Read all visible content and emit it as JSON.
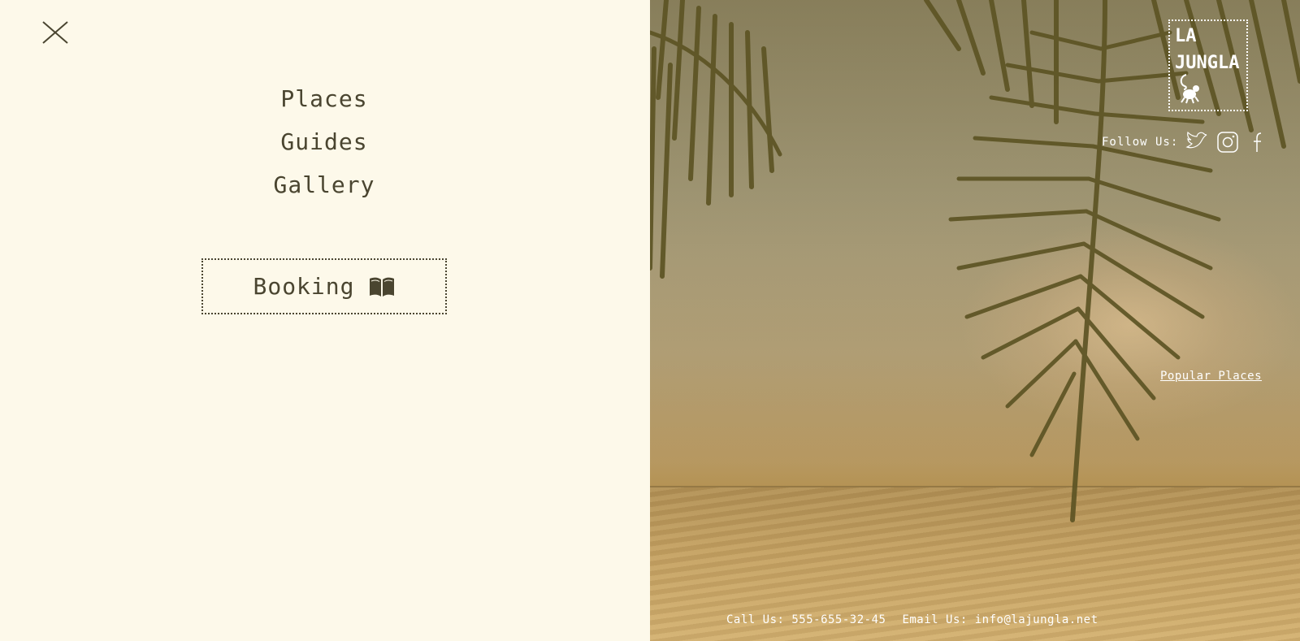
{
  "menu": {
    "close_icon": "close-icon",
    "items": [
      {
        "label": "Places"
      },
      {
        "label": "Guides"
      },
      {
        "label": "Gallery"
      }
    ],
    "booking": {
      "label": "Booking",
      "icon": "open-book-icon"
    }
  },
  "brand": {
    "line1": "LA",
    "line2": "JUNGLA",
    "icon": "monkey-icon"
  },
  "social": {
    "label": "Follow Us:",
    "icons": [
      "twitter-icon",
      "instagram-icon",
      "facebook-icon"
    ]
  },
  "hero": {
    "popular_link": "Popular Places"
  },
  "contact": {
    "phone": "Call Us: 555-655-32-45",
    "email": "Email Us: info@lajungla.net"
  },
  "colors": {
    "panel_bg": "#fdf9ea",
    "text": "#4a4530",
    "overlay_text": "#ffffff"
  }
}
